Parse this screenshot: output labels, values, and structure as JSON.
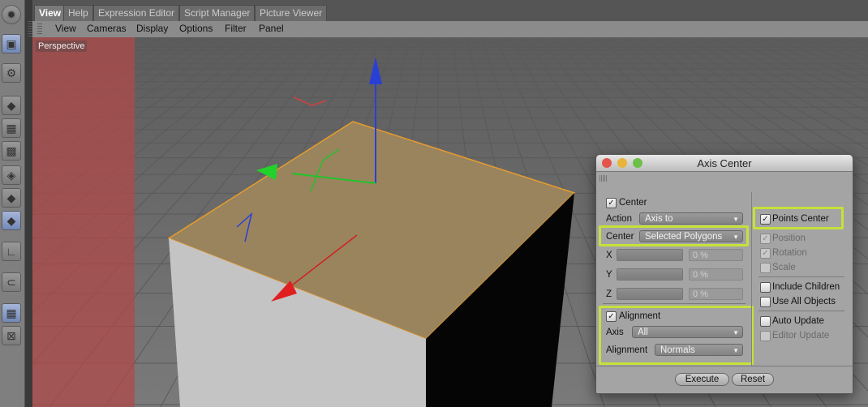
{
  "tabs": [
    "View",
    "Help",
    "Expression Editor",
    "Script Manager",
    "Picture Viewer"
  ],
  "menu": [
    "View",
    "Cameras",
    "Display",
    "Options",
    "Filter",
    "Panel"
  ],
  "viewport_label": "Perspective",
  "toolbar_icons": [
    "render-icon",
    "render-view-icon",
    "settings-icon",
    "cube-icon",
    "checker-icon",
    "texture-icon",
    "object-axis-icon",
    "model-icon",
    "polygon-tool-icon",
    "axis-tool-icon",
    "magnet-icon",
    "workplane-icon",
    "lock-icon"
  ],
  "dialog": {
    "title": "Axis Center",
    "center_label": "Center",
    "center_checked": true,
    "action_label": "Action",
    "action_value": "Axis to",
    "center_dd_label": "Center",
    "center_dd_value": "Selected Polygons",
    "x_label": "X",
    "y_label": "Y",
    "z_label": "Z",
    "x_value": "0 %",
    "y_value": "0 %",
    "z_value": "0 %",
    "alignment_label": "Alignment",
    "alignment_checked": true,
    "axis_label": "Axis",
    "axis_value": "All",
    "alignment_dd_label": "Alignment",
    "alignment_dd_value": "Normals",
    "points_center": "Points Center",
    "position": "Position",
    "rotation": "Rotation",
    "scale": "Scale",
    "include_children": "Include Children",
    "use_all_objects": "Use All Objects",
    "auto_update": "Auto Update",
    "editor_update": "Editor Update",
    "execute": "Execute",
    "reset": "Reset"
  },
  "colors": {
    "highlight": "#c7e03a",
    "face": "#9a845e",
    "red_band": "#b04a4a"
  }
}
